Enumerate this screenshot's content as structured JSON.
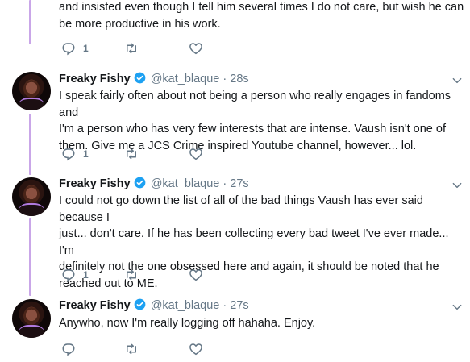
{
  "tweets": [
    {
      "text_lines": [
        "and insisted even though I tell him several times I do not care, but wish he can",
        "be more productive in his work."
      ],
      "reply_count": "1"
    },
    {
      "name": "Freaky Fishy",
      "handle": "@kat_blaque",
      "dot": "·",
      "time": "28s",
      "text_lines": [
        "I speak fairly often about not being a person who really engages in fandoms and",
        "I'm a person who has very few interests that are intense. Vaush isn't one of",
        "them. Give me a JCS Crime inspired Youtube channel, however... lol."
      ],
      "reply_count": "1"
    },
    {
      "name": "Freaky Fishy",
      "handle": "@kat_blaque",
      "dot": "·",
      "time": "27s",
      "text_lines": [
        "I could not go down the list of all of the bad things Vaush has ever said because I",
        "just... don't care. If he has been collecting every bad tweet I've ever made... I'm",
        "definitely not the one obsessed here and again, it should be noted that he",
        "reached out to ME."
      ],
      "reply_count": "1"
    },
    {
      "name": "Freaky Fishy",
      "handle": "@kat_blaque",
      "dot": "·",
      "time": "27s",
      "text_lines": [
        "Anywho, now I'm really logging off hahaha. Enjoy."
      ],
      "reply_count": ""
    }
  ],
  "icons": {
    "reply": "reply-icon",
    "retweet": "retweet-icon",
    "like": "heart-icon",
    "verified": "verified-badge-icon",
    "caret": "chevron-down-icon",
    "avatar": "avatar"
  },
  "colors": {
    "thread_line": "#c9a6e8",
    "verified": "#1da1f2",
    "secondary_text": "#657786",
    "primary_text": "#14171a"
  }
}
